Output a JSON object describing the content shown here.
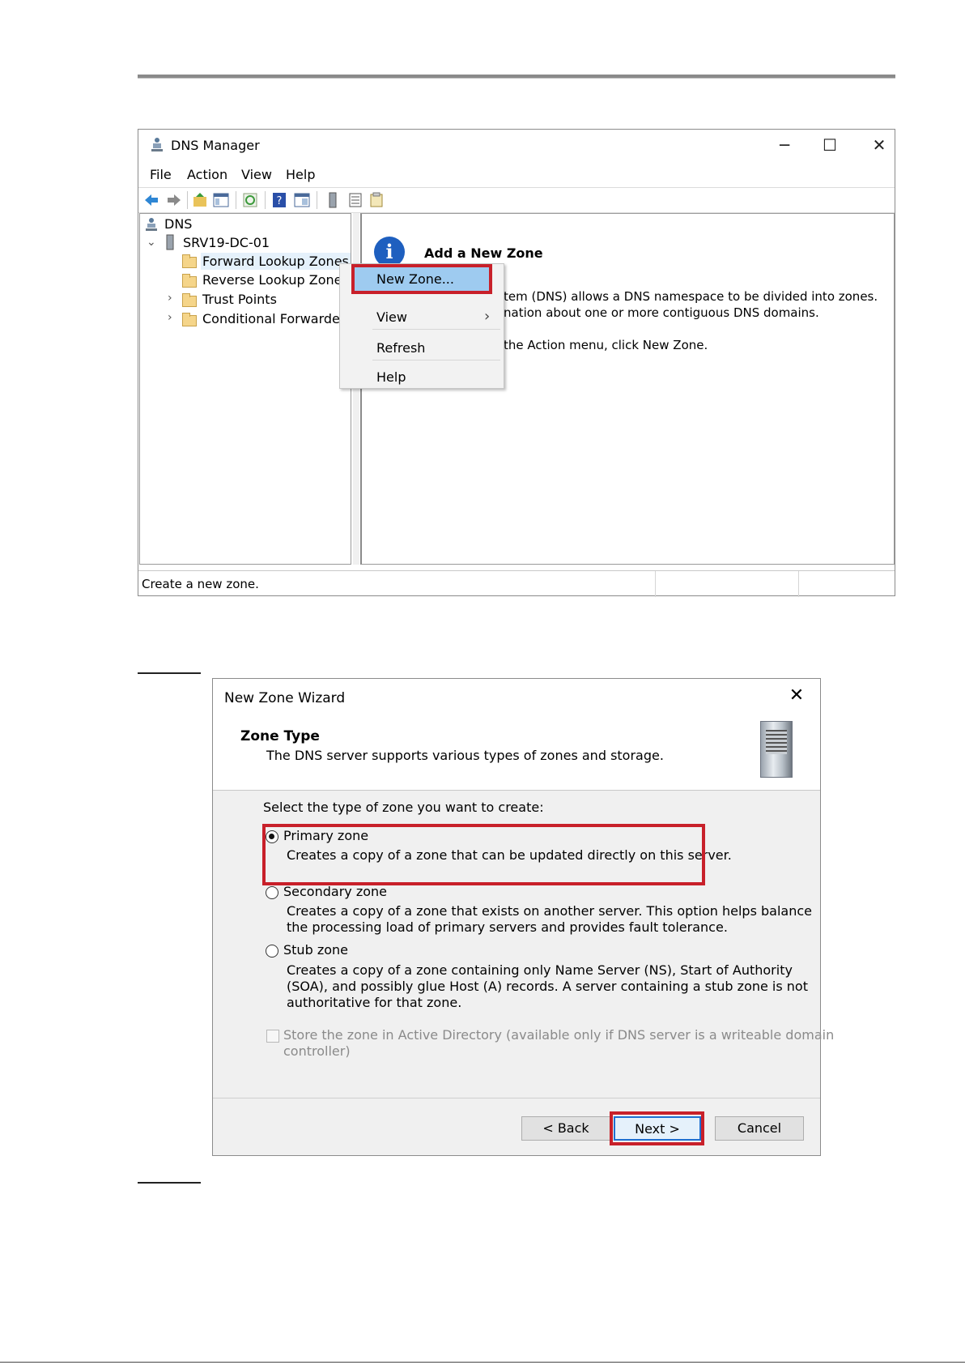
{
  "dns_manager": {
    "title": "DNS Manager",
    "window_controls": {
      "minimize": "─",
      "maximize": "☐",
      "close": "✕"
    },
    "menu": [
      "File",
      "Action",
      "View",
      "Help"
    ],
    "tree": {
      "root": "DNS",
      "server": "SRV19-DC-01",
      "children": [
        "Forward Lookup Zones",
        "Reverse Lookup Zones",
        "Trust Points",
        "Conditional Forwarders"
      ]
    },
    "content": {
      "heading": "Add a New Zone",
      "line1": "tem (DNS) allows a DNS namespace to be divided into zones.",
      "line2": "nation about one or more contiguous DNS domains.",
      "line3": "the Action menu, click New Zone."
    },
    "context_menu": {
      "new_zone": "New Zone...",
      "view": "View",
      "view_arrow": "›",
      "refresh": "Refresh",
      "help": "Help"
    },
    "status": "Create a new zone."
  },
  "wizard": {
    "title": "New Zone Wizard",
    "close": "✕",
    "heading": "Zone Type",
    "subheading": "The DNS server supports various types of zones and storage.",
    "prompt": "Select the type of zone you want to create:",
    "options": [
      {
        "label": "Primary zone",
        "selected": true,
        "desc1": "Creates a copy of a zone that can be updated directly on this server.",
        "desc2": "",
        "desc3": ""
      },
      {
        "label": "Secondary zone",
        "selected": false,
        "desc1": "Creates a copy of a zone that exists on another server. This option helps balance",
        "desc2": "the processing load of primary servers and provides fault tolerance.",
        "desc3": ""
      },
      {
        "label": "Stub zone",
        "selected": false,
        "desc1": "Creates a copy of a zone containing only Name Server (NS), Start of Authority",
        "desc2": "(SOA), and possibly glue Host (A) records. A server containing a stub zone is not",
        "desc3": "authoritative for that zone."
      }
    ],
    "store_ad_line1": "Store the zone in Active Directory (available only if DNS server is a writeable domain",
    "store_ad_line2": "controller)",
    "buttons": {
      "back": "< Back",
      "next": "Next >",
      "cancel": "Cancel"
    }
  },
  "colors": {
    "highlight_border": "#c8202a",
    "menu_highlight": "#9ecbf0",
    "selected_tree": "#e5f1fb",
    "info_blue": "#1e5fbf"
  }
}
